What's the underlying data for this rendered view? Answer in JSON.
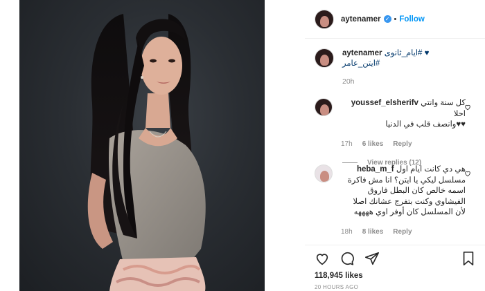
{
  "post": {
    "username": "aytenamer",
    "follow_label": "Follow",
    "dot": "•",
    "verified_glyph": "✓"
  },
  "caption": {
    "username": "aytenamer",
    "line1": "ايام_ثانوى# ♥",
    "line2": "ايتن_عامر#",
    "time": "20h"
  },
  "comments": [
    {
      "username": "youssef_elsherifv",
      "line1": "كل سنة وانتي احلا",
      "line2": "♥♥وانصف قلب في الدنيا",
      "time": "17h",
      "likes": "6 likes",
      "reply": "Reply",
      "view_replies": "View replies (12)"
    },
    {
      "username": "heba_m_f",
      "line1": "هي دي كانت ايام اول",
      "line2": "مسلسل ليكي يا ايتن؟ انا مش فاكرة",
      "line3": "اسمه خالص كان البطل فاروق",
      "line4": "الفيشاوي وكنت بتفرج عشانك اصلا",
      "line5": "لأن المسلسل كان أوفر اوي ههههه",
      "time": "18h",
      "likes": "8 likes",
      "reply": "Reply"
    }
  ],
  "actions": {
    "likes": "118,945 likes",
    "posted": "20 HOURS AGO"
  },
  "colors": {
    "accent": "#0095f6",
    "verified": "#3897f0",
    "muted": "#8e8e8e"
  }
}
